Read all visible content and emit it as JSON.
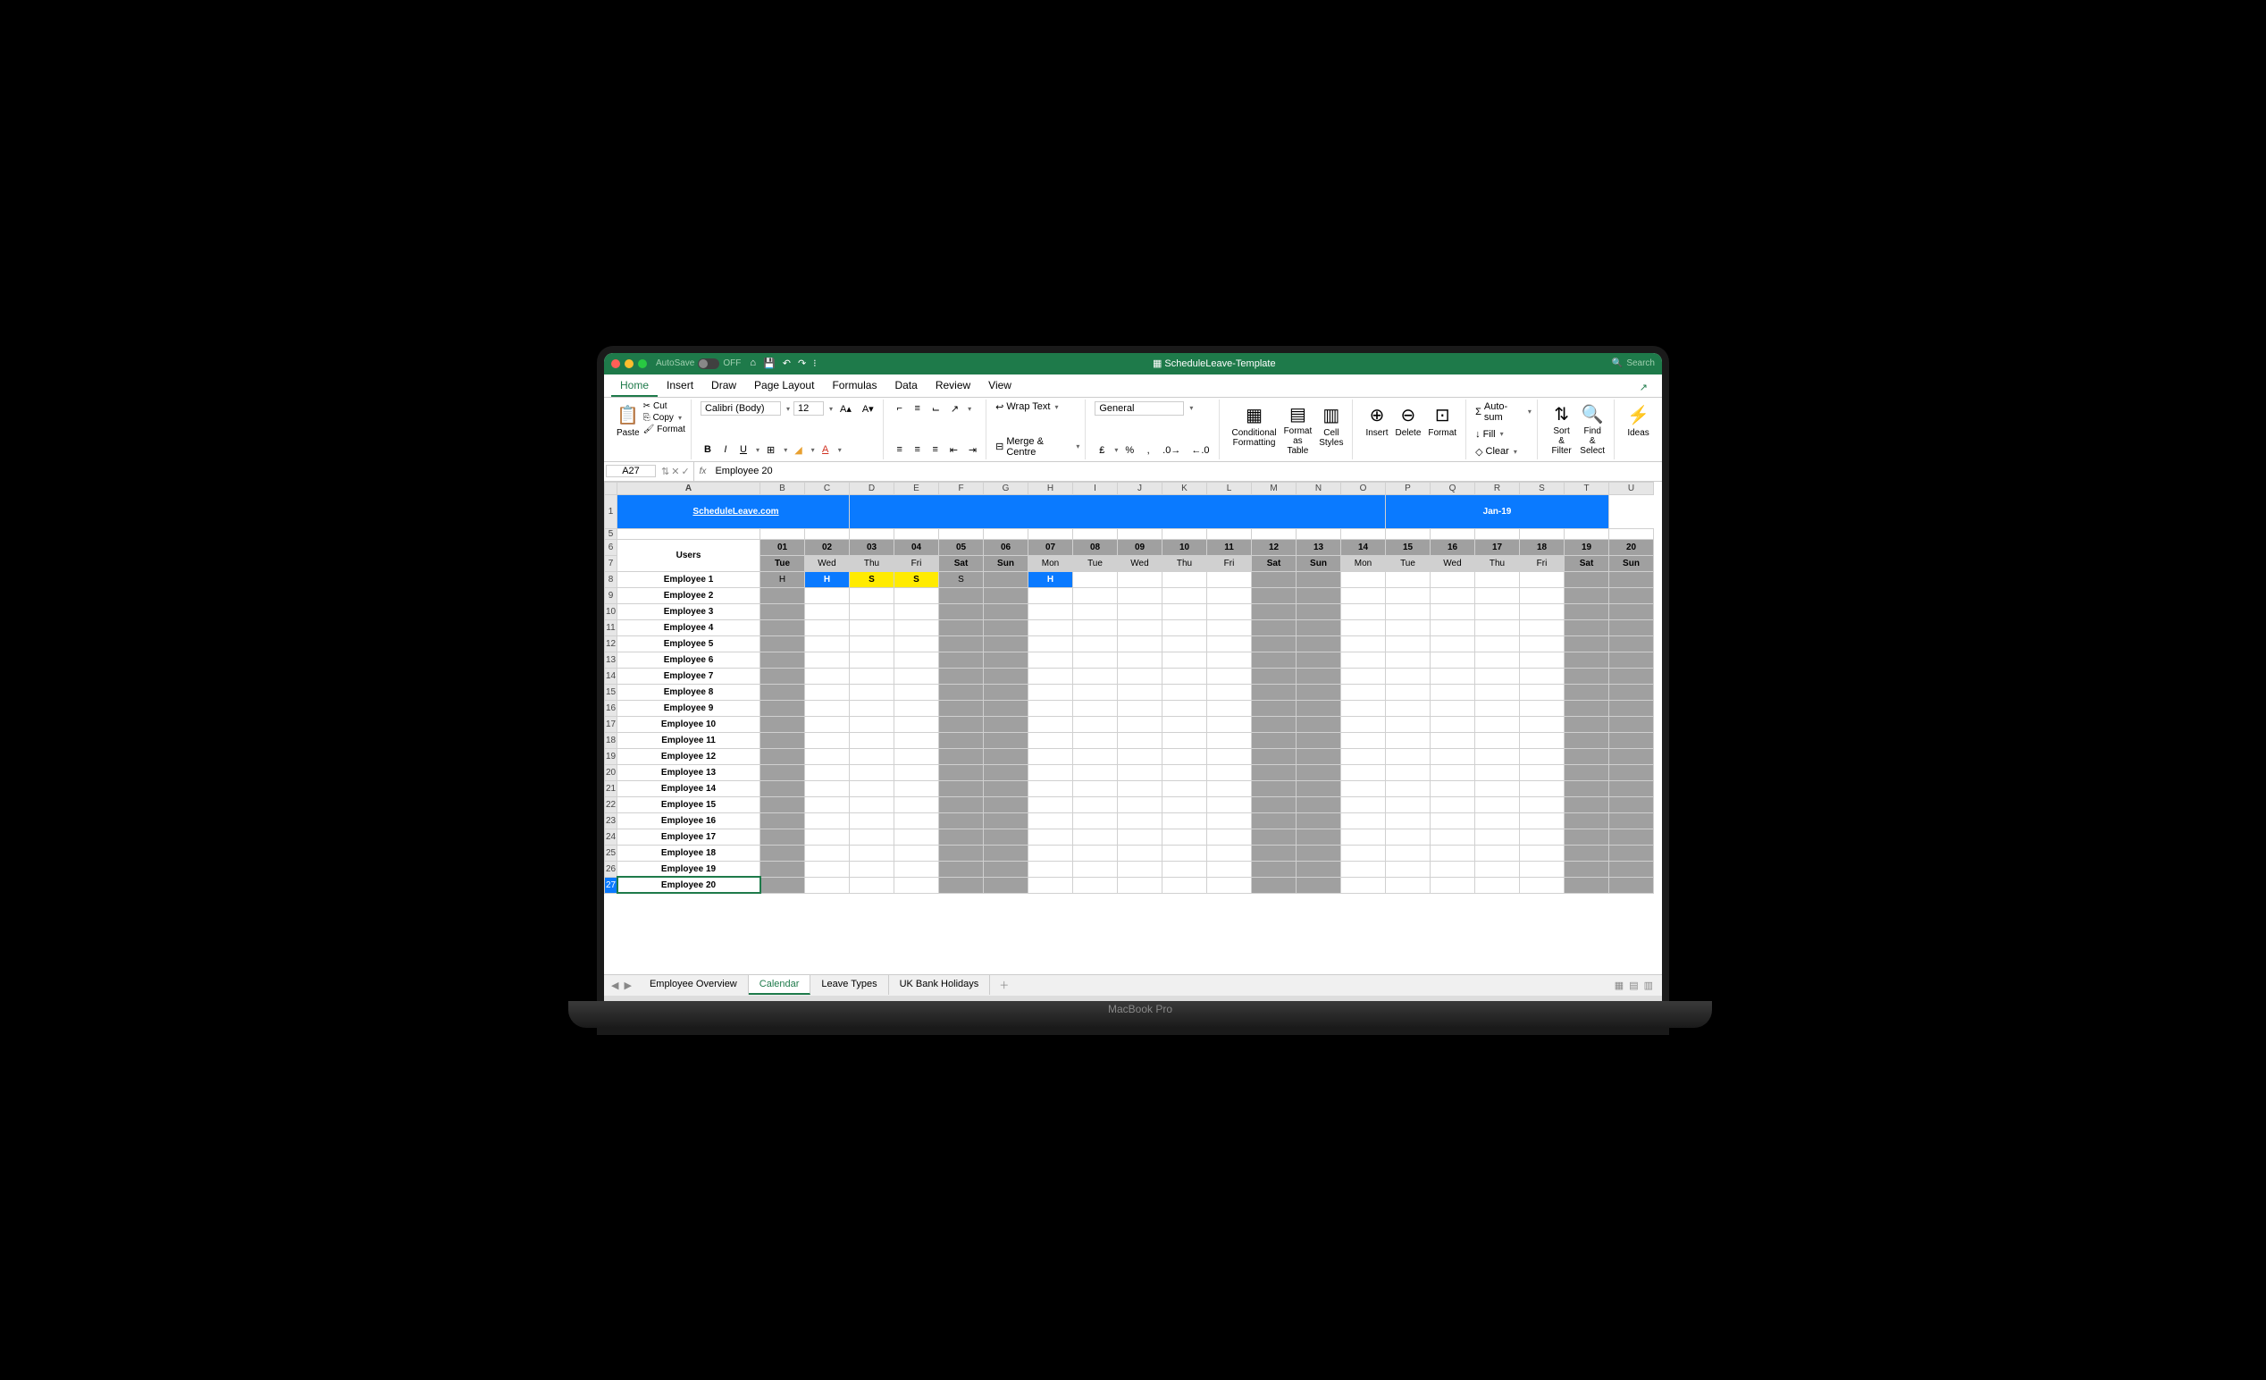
{
  "titlebar": {
    "autosave_label": "AutoSave",
    "autosave_state": "OFF",
    "doc_title": "ScheduleLeave-Template",
    "search_placeholder": "Search"
  },
  "tabs": [
    "Home",
    "Insert",
    "Draw",
    "Page Layout",
    "Formulas",
    "Data",
    "Review",
    "View"
  ],
  "active_tab": "Home",
  "ribbon": {
    "paste": "Paste",
    "cut": "Cut",
    "copy": "Copy",
    "format_painter": "Format",
    "font_name": "Calibri (Body)",
    "font_size": "12",
    "wrap_text": "Wrap Text",
    "merge_centre": "Merge & Centre",
    "number_format": "General",
    "conditional_formatting": "Conditional\nFormatting",
    "format_as_table": "Format\nas Table",
    "cell_styles": "Cell\nStyles",
    "insert": "Insert",
    "delete": "Delete",
    "format": "Format",
    "auto_sum": "Auto-sum",
    "fill": "Fill",
    "clear": "Clear",
    "sort_filter": "Sort &\nFilter",
    "find_select": "Find &\nSelect",
    "ideas": "Ideas"
  },
  "formula_bar": {
    "cell_ref": "A27",
    "formula": "Employee 20"
  },
  "columns": [
    "A",
    "B",
    "C",
    "D",
    "E",
    "F",
    "G",
    "H",
    "I",
    "J",
    "K",
    "L",
    "M",
    "N",
    "O",
    "P",
    "Q",
    "R",
    "S",
    "T",
    "U"
  ],
  "banner_title": "ScheduleLeave.com",
  "banner_month": "Jan-19",
  "dates": [
    "01",
    "02",
    "03",
    "04",
    "05",
    "06",
    "07",
    "08",
    "09",
    "10",
    "11",
    "12",
    "13",
    "14",
    "15",
    "16",
    "17",
    "18",
    "19",
    "20"
  ],
  "days": [
    "Tue",
    "Wed",
    "Thu",
    "Fri",
    "Sat",
    "Sun",
    "Mon",
    "Tue",
    "Wed",
    "Thu",
    "Fri",
    "Sat",
    "Sun",
    "Mon",
    "Tue",
    "Wed",
    "Thu",
    "Fri",
    "Sat",
    "Sun"
  ],
  "users_label": "Users",
  "weekend_cols": [
    1,
    5,
    6,
    12,
    13,
    19,
    20
  ],
  "employees": [
    {
      "name": "Employee 1",
      "row": 8,
      "cells": {
        "1": {
          "t": "H",
          "c": "weekend"
        },
        "2": {
          "t": "H",
          "c": "holiday-blue"
        },
        "3": {
          "t": "S",
          "c": "sick-yellow"
        },
        "4": {
          "t": "S",
          "c": "sick-yellow"
        },
        "5": {
          "t": "S",
          "c": "weekend"
        },
        "7": {
          "t": "H",
          "c": "holiday-blue"
        }
      }
    },
    {
      "name": "Employee 2",
      "row": 9
    },
    {
      "name": "Employee 3",
      "row": 10
    },
    {
      "name": "Employee 4",
      "row": 11
    },
    {
      "name": "Employee 5",
      "row": 12
    },
    {
      "name": "Employee 6",
      "row": 13
    },
    {
      "name": "Employee 7",
      "row": 14
    },
    {
      "name": "Employee 8",
      "row": 15
    },
    {
      "name": "Employee 9",
      "row": 16
    },
    {
      "name": "Employee 10",
      "row": 17
    },
    {
      "name": "Employee 11",
      "row": 18
    },
    {
      "name": "Employee 12",
      "row": 19
    },
    {
      "name": "Employee 13",
      "row": 20
    },
    {
      "name": "Employee 14",
      "row": 21
    },
    {
      "name": "Employee 15",
      "row": 22
    },
    {
      "name": "Employee 16",
      "row": 23
    },
    {
      "name": "Employee 17",
      "row": 24
    },
    {
      "name": "Employee 18",
      "row": 25
    },
    {
      "name": "Employee 19",
      "row": 26
    },
    {
      "name": "Employee 20",
      "row": 27
    }
  ],
  "sheet_tabs": [
    "Employee Overview",
    "Calendar",
    "Leave Types",
    "UK Bank Holidays"
  ],
  "active_sheet": "Calendar",
  "laptop_label": "MacBook Pro"
}
